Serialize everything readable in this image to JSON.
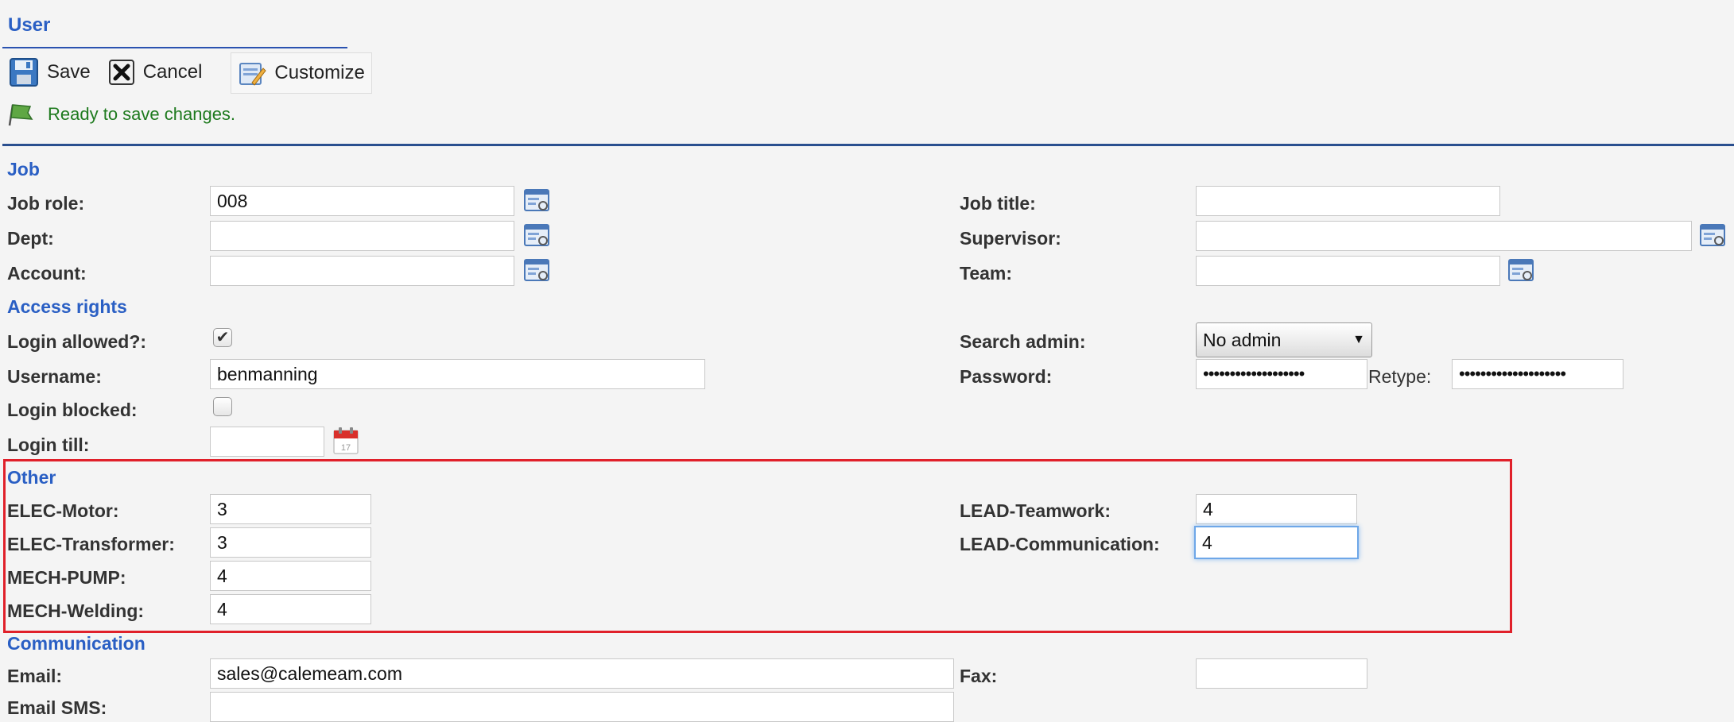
{
  "page": {
    "title": "User"
  },
  "toolbar": {
    "save": "Save",
    "cancel": "Cancel",
    "customize": "Customize"
  },
  "status": {
    "text": "Ready to save changes."
  },
  "sections": {
    "job": "Job",
    "access": "Access rights",
    "other": "Other",
    "communication": "Communication"
  },
  "job": {
    "job_role": {
      "label": "Job role:",
      "value": "008"
    },
    "dept": {
      "label": "Dept:",
      "value": ""
    },
    "account": {
      "label": "Account:",
      "value": ""
    },
    "job_title": {
      "label": "Job title:",
      "value": ""
    },
    "supervisor": {
      "label": "Supervisor:",
      "value": ""
    },
    "team": {
      "label": "Team:",
      "value": ""
    }
  },
  "access": {
    "login_allowed": {
      "label": "Login allowed?:",
      "checked": true
    },
    "username": {
      "label": "Username:",
      "value": "benmanning"
    },
    "login_blocked": {
      "label": "Login blocked:",
      "checked": false
    },
    "login_till": {
      "label": "Login till:",
      "value": ""
    },
    "search_admin": {
      "label": "Search admin:",
      "selected": "No admin"
    },
    "password": {
      "label": "Password:",
      "value": "•••••••••••••••••••"
    },
    "retype": {
      "label": "Retype:",
      "value": "••••••••••••••••••••"
    }
  },
  "other": {
    "elec_motor": {
      "label": "ELEC-Motor:",
      "value": "3"
    },
    "elec_transformer": {
      "label": "ELEC-Transformer:",
      "value": "3"
    },
    "mech_pump": {
      "label": "MECH-PUMP:",
      "value": "4"
    },
    "mech_welding": {
      "label": "MECH-Welding:",
      "value": "4"
    },
    "lead_teamwork": {
      "label": "LEAD-Teamwork:",
      "value": "4"
    },
    "lead_communication": {
      "label": "LEAD-Communication:",
      "value": "4"
    }
  },
  "communication": {
    "email": {
      "label": "Email:",
      "value": "sales@calemeam.com"
    },
    "email_sms": {
      "label": "Email SMS:",
      "value": ""
    },
    "fax": {
      "label": "Fax:",
      "value": ""
    }
  },
  "icons": {
    "save": "floppy-disk-icon",
    "cancel": "cancel-x-icon",
    "customize": "customize-form-icon",
    "status": "flag-icon",
    "lookup": "lookup-list-icon",
    "calendar": "calendar-icon"
  },
  "colors": {
    "section_title": "#2a5fc4",
    "status_text": "#1e7a1e",
    "highlight_border": "#e0202a"
  }
}
